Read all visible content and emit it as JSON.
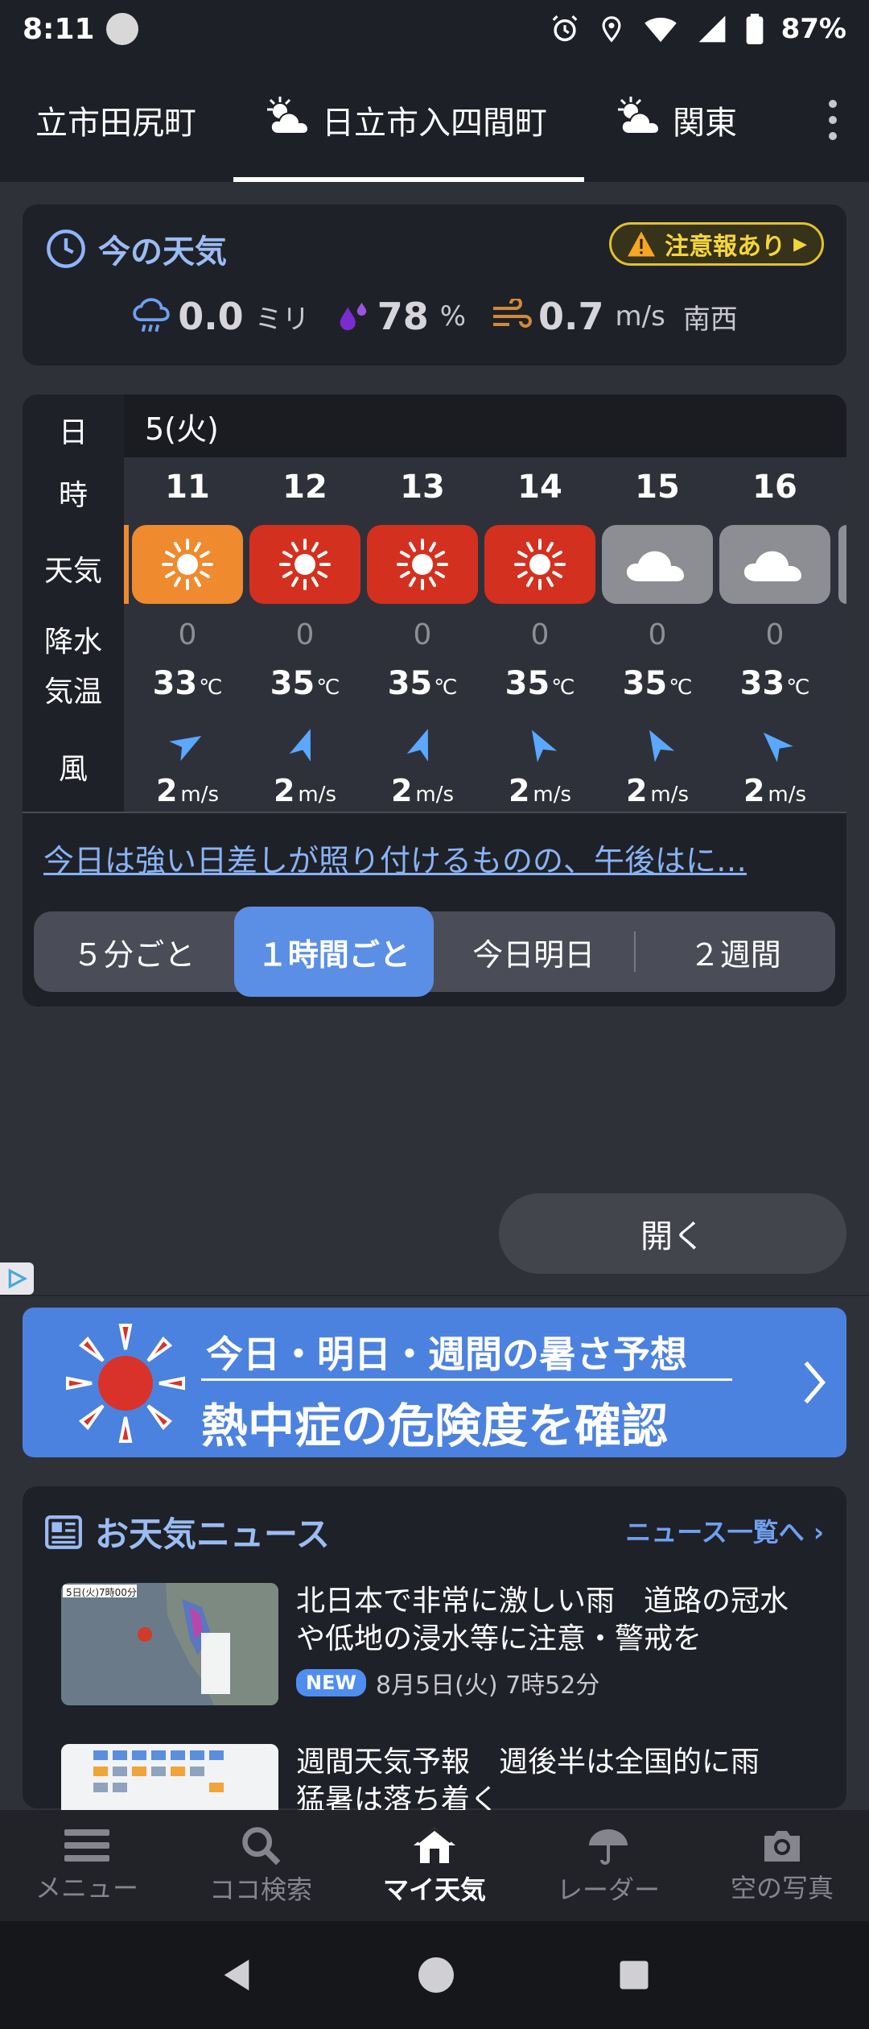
{
  "status": {
    "time": "8:11",
    "battery": "87%"
  },
  "tabs": [
    {
      "label": "立市田尻町"
    },
    {
      "label": "日立市入四間町"
    },
    {
      "label": "関東"
    }
  ],
  "now": {
    "title": "今の天気",
    "alert": "注意報あり",
    "rain_value": "0.0",
    "rain_unit": "ミリ",
    "humidity_value": "78",
    "humidity_unit": "%",
    "wind_value": "0.7",
    "wind_unit": "m/s",
    "wind_dir": "南西"
  },
  "hourly": {
    "labels": {
      "day": "日",
      "hour": "時",
      "weather": "天気",
      "precip": "降水",
      "temp": "気温",
      "wind": "風"
    },
    "date": "5(火)",
    "temp_unit": "℃",
    "wind_unit": "m/s",
    "hours": [
      {
        "hour": "11",
        "weather": "sunny",
        "precip": "0",
        "temp": "33",
        "wind": "2",
        "wind_dir_deg": 60
      },
      {
        "hour": "12",
        "weather": "hot-sunny",
        "precip": "0",
        "temp": "35",
        "wind": "2",
        "wind_dir_deg": 20
      },
      {
        "hour": "13",
        "weather": "hot-sunny",
        "precip": "0",
        "temp": "35",
        "wind": "2",
        "wind_dir_deg": 20
      },
      {
        "hour": "14",
        "weather": "hot-sunny",
        "precip": "0",
        "temp": "35",
        "wind": "2",
        "wind_dir_deg": -30
      },
      {
        "hour": "15",
        "weather": "cloudy",
        "precip": "0",
        "temp": "35",
        "wind": "2",
        "wind_dir_deg": -30
      },
      {
        "hour": "16",
        "weather": "cloudy",
        "precip": "0",
        "temp": "33",
        "wind": "2",
        "wind_dir_deg": -45
      }
    ],
    "summary_link": "今日は強い日差しが照り付けるものの、午後はに…"
  },
  "segments": {
    "five_min": "５分ごと",
    "hourly": "１時間ごと",
    "today_tomorrow": "今日明日",
    "two_weeks": "２週間"
  },
  "open_button": "開く",
  "banner": {
    "line1": "今日・明日・週間の暑さ予想",
    "line2": "熱中症の危険度を確認"
  },
  "news": {
    "title": "お天気ニュース",
    "all_link": "ニュース一覧へ",
    "items": [
      {
        "headline": "北日本で非常に激しい雨　道路の冠水や低地の浸水等に注意・警戒を",
        "badge": "NEW",
        "date": "8月5日(火) 7時52分",
        "thumb_caption": "5日(火)7時00分"
      },
      {
        "headline": "週間天気予報　週後半は全国的に雨　猛暑は落ち着く"
      }
    ]
  },
  "bottom_nav": {
    "menu": "メニュー",
    "search": "ココ検索",
    "my_weather": "マイ天気",
    "radar": "レーダー",
    "photos": "空の写真"
  },
  "colors": {
    "accent": "#5b8fe6",
    "sunny": "#ef8a2e",
    "hot": "#d4301f",
    "cloudy": "#8d8e94",
    "alert": "#f5d63a"
  }
}
